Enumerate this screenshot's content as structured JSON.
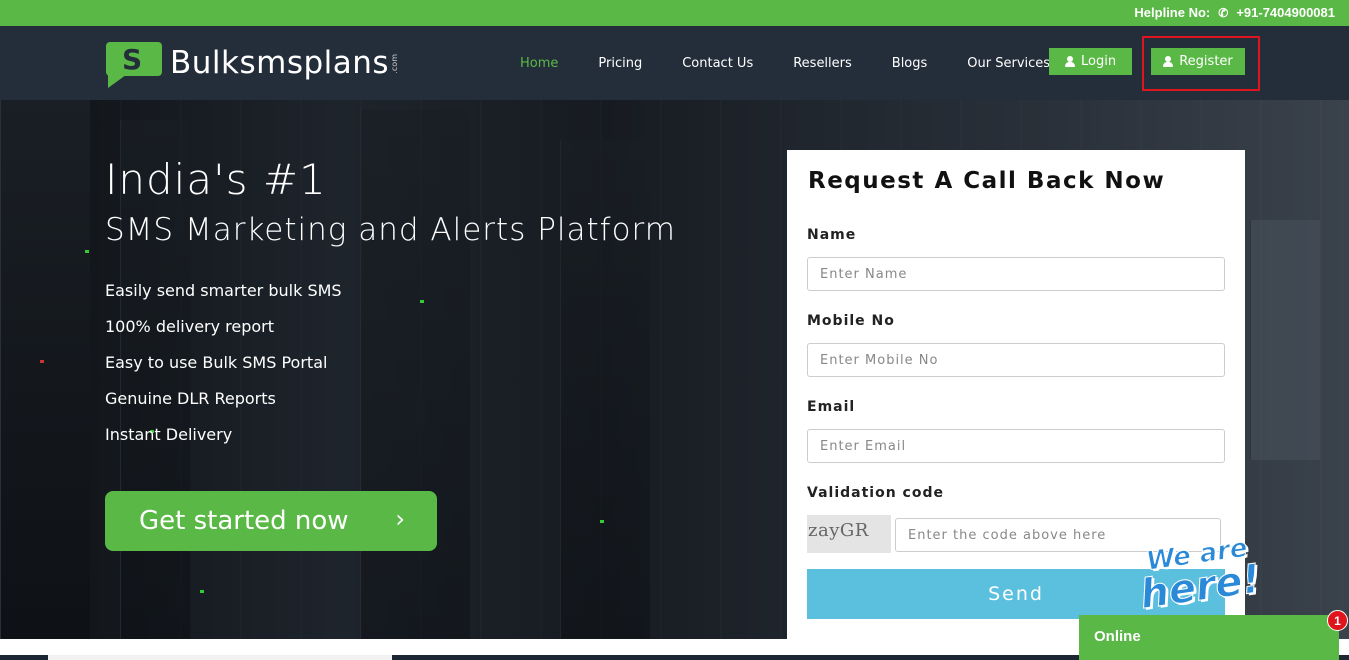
{
  "topbar": {
    "helpline_label": "Helpline No:",
    "phone": "+91-7404900081",
    "phone_icon": "phone-icon"
  },
  "brand": {
    "name": "Bulksmsplans",
    "suffix": ".com"
  },
  "nav": {
    "items": [
      {
        "label": "Home",
        "active": true
      },
      {
        "label": "Pricing",
        "active": false
      },
      {
        "label": "Contact Us",
        "active": false
      },
      {
        "label": "Resellers",
        "active": false
      },
      {
        "label": "Blogs",
        "active": false
      },
      {
        "label": "Our Services",
        "active": false
      }
    ],
    "login_label": "Login",
    "register_label": "Register"
  },
  "hero": {
    "title_line1": "India's #1",
    "title_line2": "SMS Marketing and Alerts Platform",
    "features": [
      "Easily send smarter bulk SMS",
      "100% delivery report",
      "Easy to use Bulk SMS Portal",
      "Genuine DLR Reports",
      "Instant Delivery"
    ],
    "cta_label": "Get started now",
    "cta_chevron": "›"
  },
  "form": {
    "title": "Request A Call Back Now",
    "name_label": "Name",
    "name_placeholder": "Enter Name",
    "mobile_label": "Mobile No",
    "mobile_placeholder": "Enter Mobile No",
    "email_label": "Email",
    "email_placeholder": "Enter Email",
    "validation_label": "Validation code",
    "captcha_text": "zayGR",
    "code_placeholder": "Enter the code above here",
    "send_label": "Send"
  },
  "chat": {
    "banner_line1": "We are",
    "banner_line2": "here!",
    "status": "Online",
    "unread_count": "1"
  },
  "colors": {
    "accent_green": "#5ab946",
    "nav_bg": "#242d3a",
    "send_blue": "#5bc0de",
    "highlight_red": "#e0141c"
  }
}
